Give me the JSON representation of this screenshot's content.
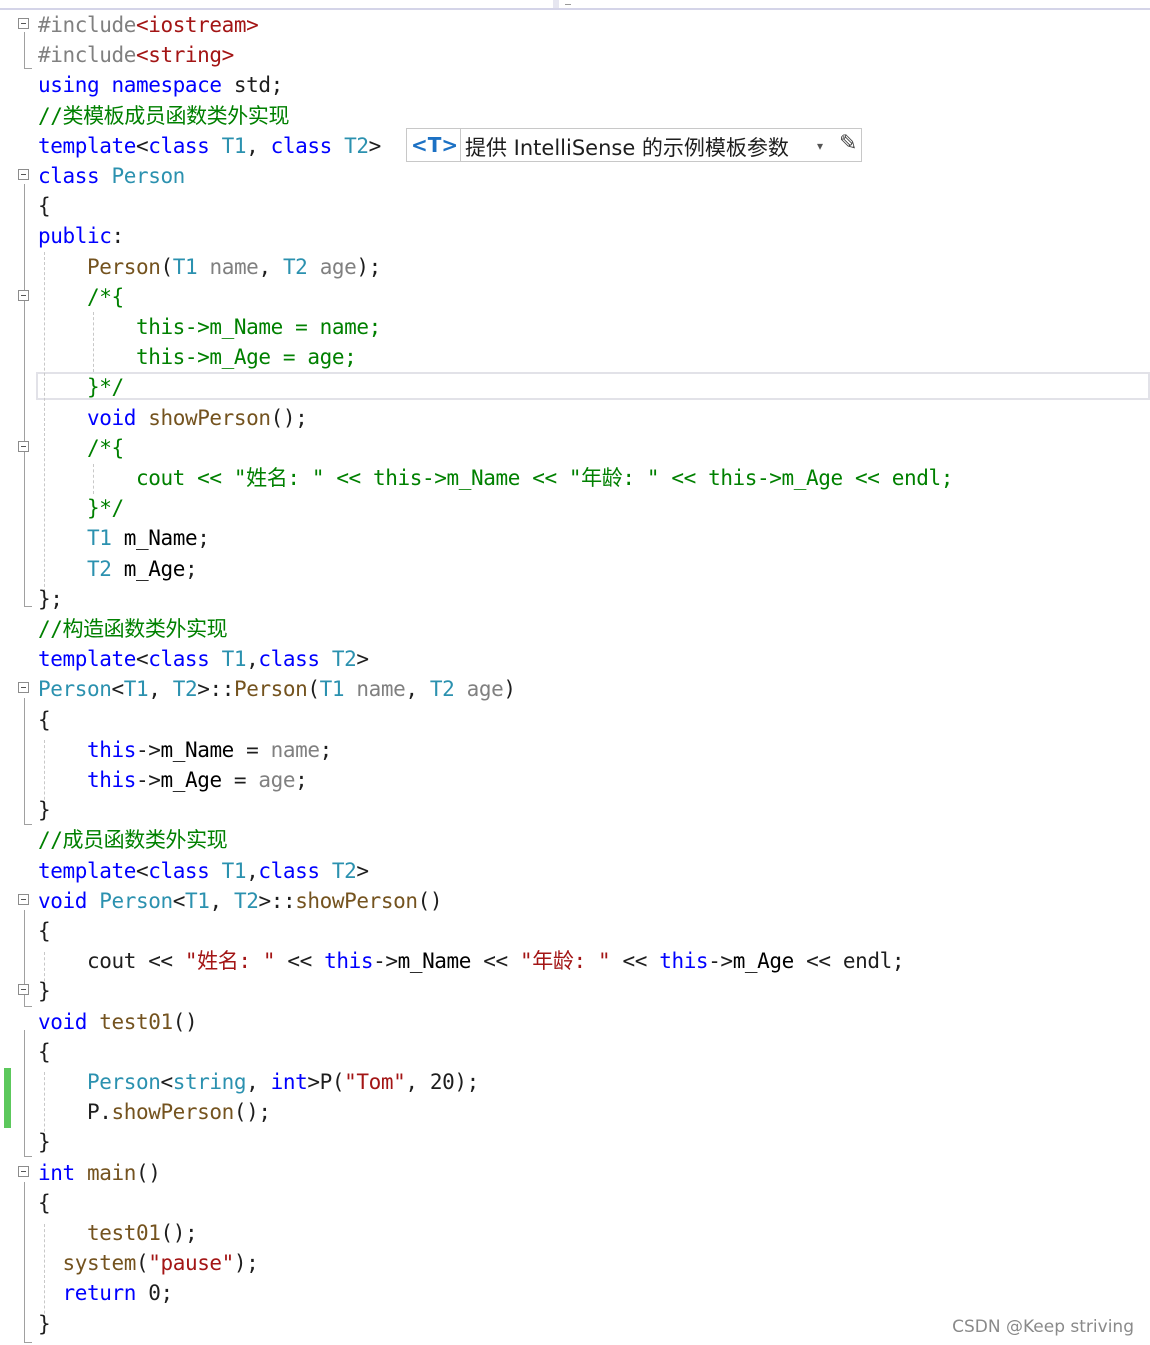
{
  "lines": [
    {
      "segs": [
        {
          "t": "#include",
          "c": "pp"
        },
        {
          "t": "<",
          "c": "ang"
        },
        {
          "t": "iostream",
          "c": "str"
        },
        {
          "t": ">",
          "c": "ang"
        }
      ]
    },
    {
      "segs": [
        {
          "t": "#include",
          "c": "pp"
        },
        {
          "t": "<",
          "c": "ang"
        },
        {
          "t": "string",
          "c": "str"
        },
        {
          "t": ">",
          "c": "ang"
        }
      ]
    },
    {
      "segs": [
        {
          "t": "using",
          "c": "kw"
        },
        {
          "t": " "
        },
        {
          "t": "namespace",
          "c": "kw"
        },
        {
          "t": " std;"
        }
      ]
    },
    {
      "segs": [
        {
          "t": "//类模板成员函数类外实现",
          "c": "cm"
        }
      ]
    },
    {
      "segs": [
        {
          "t": "template",
          "c": "kw"
        },
        {
          "t": "<"
        },
        {
          "t": "class",
          "c": "kw"
        },
        {
          "t": " "
        },
        {
          "t": "T1",
          "c": "ty"
        },
        {
          "t": ", "
        },
        {
          "t": "class",
          "c": "kw"
        },
        {
          "t": " "
        },
        {
          "t": "T2",
          "c": "ty"
        },
        {
          "t": ">"
        }
      ]
    },
    {
      "segs": [
        {
          "t": "class",
          "c": "kw"
        },
        {
          "t": " "
        },
        {
          "t": "Person",
          "c": "ty"
        }
      ]
    },
    {
      "segs": [
        {
          "t": "{"
        }
      ]
    },
    {
      "segs": [
        {
          "t": "public",
          "c": "kw"
        },
        {
          "t": ":"
        }
      ]
    },
    {
      "segs": [
        {
          "t": "    "
        },
        {
          "t": "Person",
          "c": "fn"
        },
        {
          "t": "("
        },
        {
          "t": "T1",
          "c": "ty"
        },
        {
          "t": " "
        },
        {
          "t": "name",
          "c": "par"
        },
        {
          "t": ", "
        },
        {
          "t": "T2",
          "c": "ty"
        },
        {
          "t": " "
        },
        {
          "t": "age",
          "c": "par"
        },
        {
          "t": ");"
        }
      ]
    },
    {
      "segs": [
        {
          "t": "    "
        },
        {
          "t": "/*{",
          "c": "cm"
        }
      ]
    },
    {
      "segs": [
        {
          "t": "        "
        },
        {
          "t": "this->m_Name = name;",
          "c": "cm"
        }
      ]
    },
    {
      "segs": [
        {
          "t": "        "
        },
        {
          "t": "this->m_Age = age;",
          "c": "cm"
        }
      ]
    },
    {
      "segs": [
        {
          "t": "    "
        },
        {
          "t": "}*/",
          "c": "cm"
        }
      ]
    },
    {
      "segs": [
        {
          "t": "    "
        },
        {
          "t": "void",
          "c": "kw"
        },
        {
          "t": " "
        },
        {
          "t": "showPerson",
          "c": "fn"
        },
        {
          "t": "();"
        }
      ]
    },
    {
      "segs": [
        {
          "t": "    "
        },
        {
          "t": "/*{",
          "c": "cm"
        }
      ]
    },
    {
      "segs": [
        {
          "t": "        "
        },
        {
          "t": "cout << \"姓名: \" << this->m_Name << \"年龄: \" << this->m_Age << endl;",
          "c": "cm"
        }
      ]
    },
    {
      "segs": [
        {
          "t": "    "
        },
        {
          "t": "}*/",
          "c": "cm"
        }
      ]
    },
    {
      "segs": [
        {
          "t": "    "
        },
        {
          "t": "T1",
          "c": "ty"
        },
        {
          "t": " "
        },
        {
          "t": "m_Name",
          "c": "mem"
        },
        {
          "t": ";"
        }
      ]
    },
    {
      "segs": [
        {
          "t": "    "
        },
        {
          "t": "T2",
          "c": "ty"
        },
        {
          "t": " "
        },
        {
          "t": "m_Age",
          "c": "mem"
        },
        {
          "t": ";"
        }
      ]
    },
    {
      "segs": [
        {
          "t": "};"
        }
      ]
    },
    {
      "segs": [
        {
          "t": "//构造函数类外实现",
          "c": "cm"
        }
      ]
    },
    {
      "segs": [
        {
          "t": "template",
          "c": "kw"
        },
        {
          "t": "<"
        },
        {
          "t": "class",
          "c": "kw"
        },
        {
          "t": " "
        },
        {
          "t": "T1",
          "c": "ty"
        },
        {
          "t": ","
        },
        {
          "t": "class",
          "c": "kw"
        },
        {
          "t": " "
        },
        {
          "t": "T2",
          "c": "ty"
        },
        {
          "t": ">"
        }
      ]
    },
    {
      "segs": [
        {
          "t": "Person",
          "c": "ty"
        },
        {
          "t": "<"
        },
        {
          "t": "T1",
          "c": "ty"
        },
        {
          "t": ", "
        },
        {
          "t": "T2",
          "c": "ty"
        },
        {
          "t": ">::"
        },
        {
          "t": "Person",
          "c": "fn"
        },
        {
          "t": "("
        },
        {
          "t": "T1",
          "c": "ty"
        },
        {
          "t": " "
        },
        {
          "t": "name",
          "c": "par"
        },
        {
          "t": ", "
        },
        {
          "t": "T2",
          "c": "ty"
        },
        {
          "t": " "
        },
        {
          "t": "age",
          "c": "par"
        },
        {
          "t": ")"
        }
      ]
    },
    {
      "segs": [
        {
          "t": "{"
        }
      ]
    },
    {
      "segs": [
        {
          "t": "    "
        },
        {
          "t": "this",
          "c": "kw"
        },
        {
          "t": "->"
        },
        {
          "t": "m_Name",
          "c": "mem"
        },
        {
          "t": " = "
        },
        {
          "t": "name",
          "c": "par"
        },
        {
          "t": ";"
        }
      ]
    },
    {
      "segs": [
        {
          "t": "    "
        },
        {
          "t": "this",
          "c": "kw"
        },
        {
          "t": "->"
        },
        {
          "t": "m_Age",
          "c": "mem"
        },
        {
          "t": " = "
        },
        {
          "t": "age",
          "c": "par"
        },
        {
          "t": ";"
        }
      ]
    },
    {
      "segs": [
        {
          "t": "}"
        }
      ]
    },
    {
      "segs": [
        {
          "t": "//成员函数类外实现",
          "c": "cm"
        }
      ]
    },
    {
      "segs": [
        {
          "t": "template",
          "c": "kw"
        },
        {
          "t": "<"
        },
        {
          "t": "class",
          "c": "kw"
        },
        {
          "t": " "
        },
        {
          "t": "T1",
          "c": "ty"
        },
        {
          "t": ","
        },
        {
          "t": "class",
          "c": "kw"
        },
        {
          "t": " "
        },
        {
          "t": "T2",
          "c": "ty"
        },
        {
          "t": ">"
        }
      ]
    },
    {
      "segs": [
        {
          "t": "void",
          "c": "kw"
        },
        {
          "t": " "
        },
        {
          "t": "Person",
          "c": "ty"
        },
        {
          "t": "<"
        },
        {
          "t": "T1",
          "c": "ty"
        },
        {
          "t": ", "
        },
        {
          "t": "T2",
          "c": "ty"
        },
        {
          "t": ">::"
        },
        {
          "t": "showPerson",
          "c": "fn"
        },
        {
          "t": "()"
        }
      ]
    },
    {
      "segs": [
        {
          "t": "{"
        }
      ]
    },
    {
      "segs": [
        {
          "t": "    cout << "
        },
        {
          "t": "\"姓名: \"",
          "c": "str"
        },
        {
          "t": " << "
        },
        {
          "t": "this",
          "c": "kw"
        },
        {
          "t": "->"
        },
        {
          "t": "m_Name",
          "c": "mem"
        },
        {
          "t": " << "
        },
        {
          "t": "\"年龄: \"",
          "c": "str"
        },
        {
          "t": " << "
        },
        {
          "t": "this",
          "c": "kw"
        },
        {
          "t": "->"
        },
        {
          "t": "m_Age",
          "c": "mem"
        },
        {
          "t": " << endl;"
        }
      ]
    },
    {
      "segs": [
        {
          "t": "}"
        }
      ]
    },
    {
      "segs": [
        {
          "t": "void",
          "c": "kw"
        },
        {
          "t": " "
        },
        {
          "t": "test01",
          "c": "fn"
        },
        {
          "t": "()"
        }
      ]
    },
    {
      "segs": [
        {
          "t": "{"
        }
      ]
    },
    {
      "segs": [
        {
          "t": "    "
        },
        {
          "t": "Person",
          "c": "ty"
        },
        {
          "t": "<"
        },
        {
          "t": "string",
          "c": "ty"
        },
        {
          "t": ", "
        },
        {
          "t": "int",
          "c": "kw"
        },
        {
          "t": ">P("
        },
        {
          "t": "\"Tom\"",
          "c": "str"
        },
        {
          "t": ", 20);"
        }
      ]
    },
    {
      "segs": [
        {
          "t": "    P."
        },
        {
          "t": "showPerson",
          "c": "fn"
        },
        {
          "t": "();"
        }
      ]
    },
    {
      "segs": [
        {
          "t": "}"
        }
      ]
    },
    {
      "segs": [
        {
          "t": "int",
          "c": "kw"
        },
        {
          "t": " "
        },
        {
          "t": "main",
          "c": "fn"
        },
        {
          "t": "()"
        }
      ]
    },
    {
      "segs": [
        {
          "t": "{"
        }
      ]
    },
    {
      "segs": [
        {
          "t": "    "
        },
        {
          "t": "test01",
          "c": "fn"
        },
        {
          "t": "();"
        }
      ]
    },
    {
      "segs": [
        {
          "t": "  "
        },
        {
          "t": "system",
          "c": "fn"
        },
        {
          "t": "("
        },
        {
          "t": "\"pause\"",
          "c": "str"
        },
        {
          "t": ");"
        }
      ]
    },
    {
      "segs": [
        {
          "t": "  "
        },
        {
          "t": "return",
          "c": "kw"
        },
        {
          "t": " 0;"
        }
      ]
    },
    {
      "segs": [
        {
          "t": "}"
        }
      ]
    }
  ],
  "intellisense": {
    "badge": "<T>",
    "label": "提供 IntelliSense 的示例模板参数",
    "caret": "▾",
    "edit_icon": "✎"
  },
  "watermark": "CSDN @Keep striving",
  "colors": {
    "keyword": "#0000ff",
    "type": "#2b91af",
    "string": "#a31515",
    "comment": "#008000",
    "preprocessor": "#808080",
    "parameter": "#808080",
    "function": "#74531f",
    "change_bar": "#5cc85c"
  }
}
